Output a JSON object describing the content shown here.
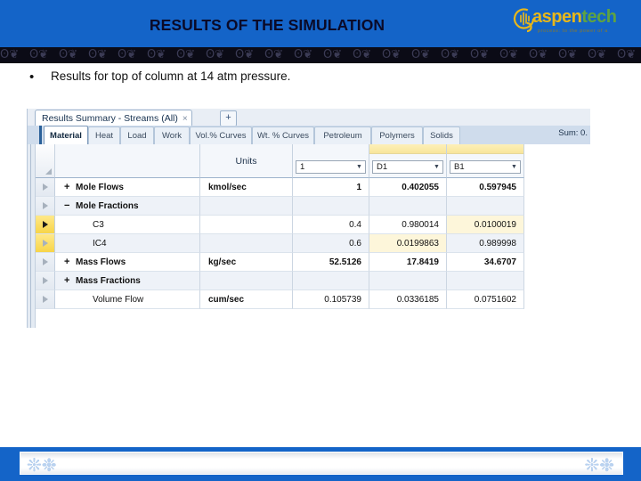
{
  "slide": {
    "title": "RESULTS OF THE SIMULATION",
    "bullet_marker": "•",
    "bullet_text": "Results for top of column at 14 atm pressure."
  },
  "logo": {
    "name_part1": "aspen",
    "name_part2": "tech",
    "tagline": "process: to the power of a",
    "color_aspen": "#E8B71A",
    "color_tech": "#5FA342",
    "brand_blue": "#1464C8"
  },
  "aspen": {
    "document_tab": {
      "label": "Results Summary - Streams (All)",
      "close_glyph": "×",
      "new_tab_glyph": "+"
    },
    "category_tabs": [
      {
        "label": "Material",
        "active": true
      },
      {
        "label": "Heat",
        "active": false
      },
      {
        "label": "Load",
        "active": false
      },
      {
        "label": "Work",
        "active": false
      },
      {
        "label": "Vol.% Curves",
        "active": false
      },
      {
        "label": "Wt. % Curves",
        "active": false
      },
      {
        "label": "Petroleum",
        "active": false
      },
      {
        "label": "Polymers",
        "active": false
      },
      {
        "label": "Solids",
        "active": false
      }
    ],
    "sum_label": "Sum: 0.",
    "grid": {
      "columns": [
        {
          "header": "",
          "kind": "selector"
        },
        {
          "header": "",
          "kind": "label"
        },
        {
          "header": "Units",
          "kind": "units"
        },
        {
          "header": "1",
          "kind": "combo",
          "highlighted": false
        },
        {
          "header": "D1",
          "kind": "combo",
          "highlighted": true
        },
        {
          "header": "B1",
          "kind": "combo",
          "highlighted": true
        }
      ],
      "rows": [
        {
          "expander": "+",
          "label": "Mole Flows",
          "units": "kmol/sec",
          "values": [
            "1",
            "0.402055",
            "0.597945"
          ],
          "indent": false,
          "bold": true,
          "band": false,
          "selector_hot": false,
          "selector_dark": false,
          "value_highlight": [
            false,
            false,
            false
          ]
        },
        {
          "expander": "−",
          "label": "Mole Fractions",
          "units": "",
          "values": [
            "",
            "",
            ""
          ],
          "indent": false,
          "bold": true,
          "band": true,
          "selector_hot": false,
          "selector_dark": false,
          "value_highlight": [
            false,
            false,
            false
          ]
        },
        {
          "expander": "",
          "label": "C3",
          "units": "",
          "values": [
            "0.4",
            "0.980014",
            "0.0100019"
          ],
          "indent": true,
          "bold": false,
          "band": false,
          "selector_hot": true,
          "selector_dark": true,
          "value_highlight": [
            false,
            false,
            true
          ]
        },
        {
          "expander": "",
          "label": "IC4",
          "units": "",
          "values": [
            "0.6",
            "0.0199863",
            "0.989998"
          ],
          "indent": true,
          "bold": false,
          "band": true,
          "selector_hot": true,
          "selector_dark": false,
          "value_highlight": [
            false,
            true,
            false
          ]
        },
        {
          "expander": "+",
          "label": "Mass Flows",
          "units": "kg/sec",
          "values": [
            "52.5126",
            "17.8419",
            "34.6707"
          ],
          "indent": false,
          "bold": true,
          "band": false,
          "selector_hot": false,
          "selector_dark": false,
          "value_highlight": [
            false,
            false,
            false
          ]
        },
        {
          "expander": "+",
          "label": "Mass Fractions",
          "units": "",
          "values": [
            "",
            "",
            ""
          ],
          "indent": false,
          "bold": true,
          "band": true,
          "selector_hot": false,
          "selector_dark": false,
          "value_highlight": [
            false,
            false,
            false
          ]
        },
        {
          "expander": "",
          "label": "Volume Flow",
          "units": "cum/sec",
          "values": [
            "0.105739",
            "0.0336185",
            "0.0751602"
          ],
          "indent": true,
          "bold": false,
          "band": false,
          "selector_hot": false,
          "selector_dark": false,
          "value_highlight": [
            false,
            false,
            false
          ]
        }
      ]
    }
  }
}
